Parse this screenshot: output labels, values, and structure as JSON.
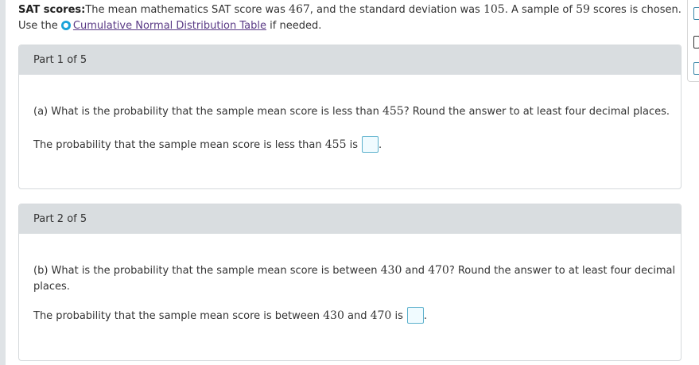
{
  "intro": {
    "heading": "SAT scores:",
    "sentence_pre": "The mean mathematics SAT score was ",
    "mean": "467",
    "sentence_mid": ", and the standard deviation was ",
    "sd": "105",
    "sentence_post": ". A sample of ",
    "n": "59",
    "sentence_end": " scores is chosen.",
    "use_the": "Use the",
    "link_label": "Cumulative Normal Distribution Table",
    "if_needed": "if needed."
  },
  "parts": [
    {
      "header": "Part 1 of 5",
      "question_pre": "(a) What is the probability that the sample mean score is less than ",
      "question_value": "455",
      "question_post": "? Round the answer to at least four decimal places.",
      "answer_pre": "The probability that the sample mean score is less than ",
      "answer_value": "455",
      "answer_post": " is"
    },
    {
      "header": "Part 2 of 5",
      "question_pre": "(b) What is the probability that the sample mean score is between ",
      "question_value1": "430",
      "question_and": " and ",
      "question_value2": "470",
      "question_post": "? Round the answer to at least four decimal",
      "question_line2": "places.",
      "answer_pre": "The probability that the sample mean score is between ",
      "answer_value1": "430",
      "answer_and": " and ",
      "answer_value2": "470",
      "answer_post": " is"
    }
  ],
  "period": ".",
  "icons": [
    "info-icon",
    "calculator-icon",
    "data-icon",
    "chart-icon"
  ],
  "colors": {
    "link": "#5a3a86",
    "panel_header": "#d9dde0",
    "answer_border": "#5bb0cc",
    "info": "#1aa3d9"
  }
}
